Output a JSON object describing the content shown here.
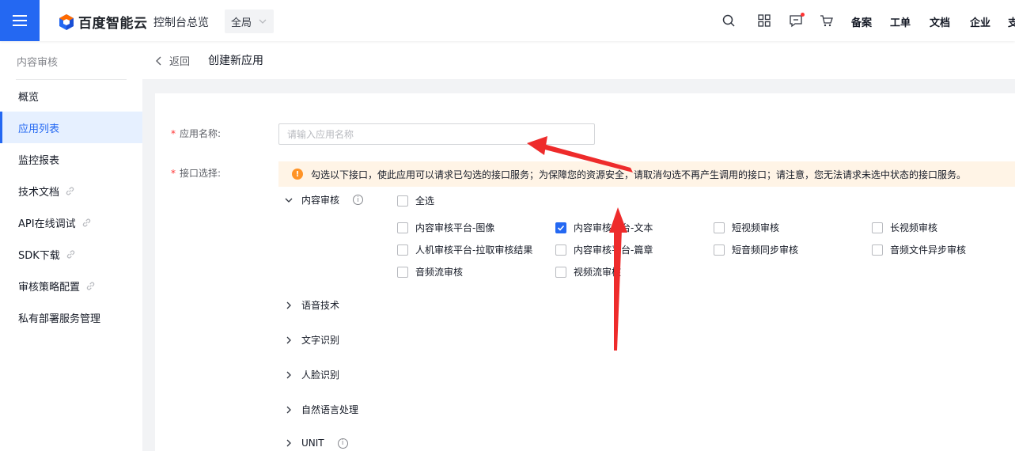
{
  "topbar": {
    "brand": "百度智能云",
    "console_overview": "控制台总览",
    "region": "全局",
    "links": [
      "备案",
      "工单",
      "文档",
      "企业",
      "支"
    ]
  },
  "sidebar": {
    "title": "内容审核",
    "items": [
      {
        "label": "概览",
        "active": false,
        "external": false
      },
      {
        "label": "应用列表",
        "active": true,
        "external": false
      },
      {
        "label": "监控报表",
        "active": false,
        "external": false
      },
      {
        "label": "技术文档",
        "active": false,
        "external": true
      },
      {
        "label": "API在线调试",
        "active": false,
        "external": true
      },
      {
        "label": "SDK下载",
        "active": false,
        "external": true
      },
      {
        "label": "审核策略配置",
        "active": false,
        "external": true
      },
      {
        "label": "私有部署服务管理",
        "active": false,
        "external": false
      }
    ]
  },
  "header": {
    "back_label": "返回",
    "title": "创建新应用"
  },
  "form": {
    "app_name_label": "应用名称:",
    "app_name_placeholder": "请输入应用名称",
    "app_name_value": "",
    "interface_label": "接口选择:",
    "notice": "勾选以下接口，使此应用可以请求已勾选的接口服务；为保障您的资源安全，请取消勾选不再产生调用的接口；请注意，您无法请求未选中状态的接口服务。",
    "groups": [
      {
        "label": "内容审核",
        "expanded": true,
        "info": true
      },
      {
        "label": "语音技术",
        "expanded": false,
        "info": false
      },
      {
        "label": "文字识别",
        "expanded": false,
        "info": false
      },
      {
        "label": "人脸识别",
        "expanded": false,
        "info": false
      },
      {
        "label": "自然语言处理",
        "expanded": false,
        "info": false
      },
      {
        "label": "UNIT",
        "expanded": false,
        "info": true
      }
    ],
    "select_all": {
      "label": "全选",
      "checked": false
    },
    "options": [
      {
        "label": "内容审核平台-图像",
        "checked": false
      },
      {
        "label": "内容审核平台-文本",
        "checked": true
      },
      {
        "label": "短视频审核",
        "checked": false
      },
      {
        "label": "长视频审核",
        "checked": false
      },
      {
        "label": "人机审核平台-拉取审核结果",
        "checked": false
      },
      {
        "label": "内容审核平台-篇章",
        "checked": false
      },
      {
        "label": "短音频同步审核",
        "checked": false
      },
      {
        "label": "音频文件异步审核",
        "checked": false
      },
      {
        "label": "音频流审核",
        "checked": false
      },
      {
        "label": "视频流审核",
        "checked": false
      }
    ]
  },
  "colors": {
    "primary": "#2468f2",
    "annotation_arrow": "#ee2b2b",
    "notice_bg": "#fff4e6",
    "warning": "#ff9326"
  }
}
